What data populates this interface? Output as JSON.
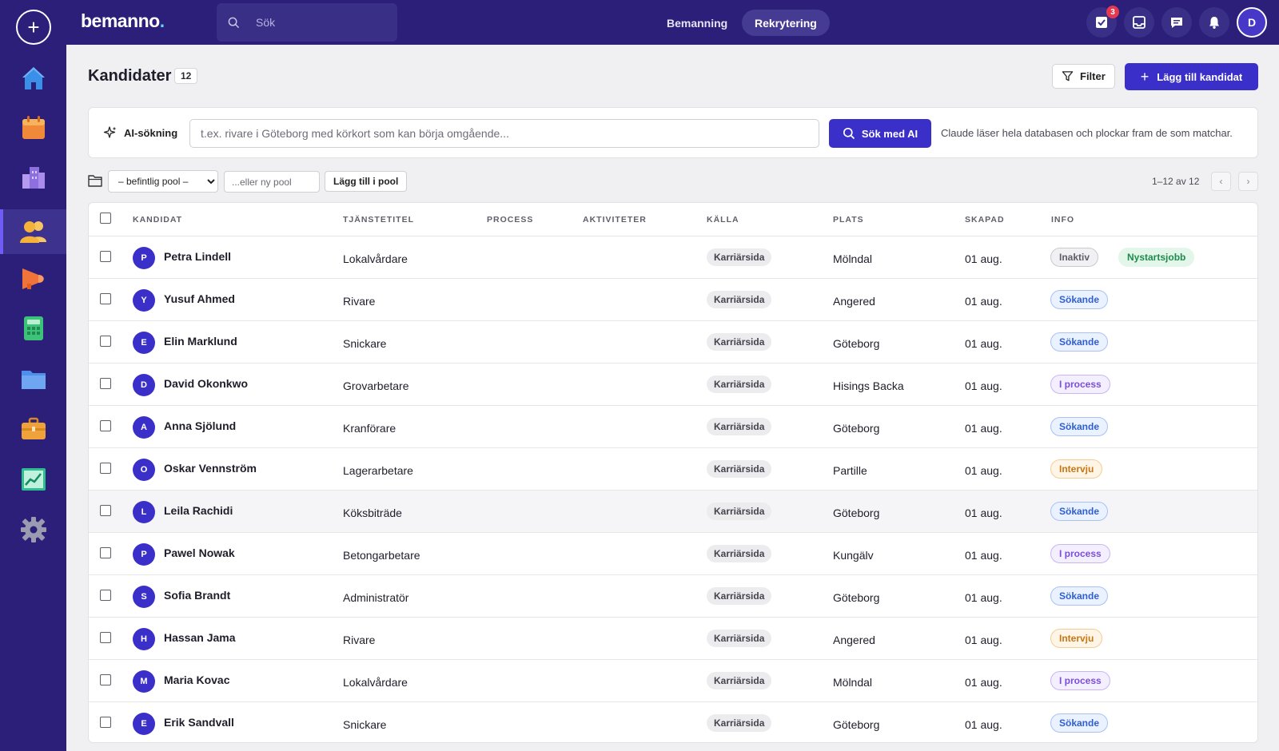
{
  "app": {
    "logo": "bemanno",
    "logo_dot": "."
  },
  "search": {
    "placeholder": "Sök"
  },
  "nav": {
    "tabs": [
      {
        "label": "Bemanning"
      },
      {
        "label": "Rekrytering"
      }
    ]
  },
  "top_actions": {
    "tasks_badge": "3",
    "user_initial": "D"
  },
  "sidebar": {
    "items": [
      {
        "icon": "home-icon",
        "color": "#3a8fe8"
      },
      {
        "icon": "calendar-icon",
        "color": "#f08a3a"
      },
      {
        "icon": "building-icon",
        "color": "#8e6fe0"
      },
      {
        "icon": "users-icon",
        "color": "#f4b23a"
      },
      {
        "icon": "megaphone-icon",
        "color": "#f0733a"
      },
      {
        "icon": "calculator-icon",
        "color": "#3dc27a"
      },
      {
        "icon": "folder-icon",
        "color": "#4d8fea"
      },
      {
        "icon": "briefcase-icon",
        "color": "#f0a23a"
      },
      {
        "icon": "chart-icon",
        "color": "#2fbf8f"
      },
      {
        "icon": "settings-icon",
        "color": "#9a9ab0"
      }
    ]
  },
  "header": {
    "title": "Kandidater",
    "count": "12",
    "filter_label": "Filter",
    "add_label": "Lägg till kandidat"
  },
  "ai_search": {
    "label": "AI-sökning",
    "placeholder": "t.ex. rivare i Göteborg med körkort som kan börja omgående...",
    "button": "Sök med AI",
    "hint": "Claude läser hela databasen och plockar fram de som matchar."
  },
  "pool": {
    "select_value": "– befintlig pool –",
    "new_placeholder": "...eller ny pool",
    "add_button": "Lägg till i pool",
    "pager_text": "1–12 av 12",
    "prev": "‹",
    "next": "›"
  },
  "table": {
    "columns": [
      "KANDIDAT",
      "TJÄNSTETITEL",
      "PROCESS",
      "AKTIVITETER",
      "KÄLLA",
      "PLATS",
      "SKAPAD",
      "INFO"
    ],
    "rows": [
      {
        "initial": "P",
        "name": "Petra Lindell",
        "title": "Lokalvårdare",
        "source": "Karriärsida",
        "place": "Mölndal",
        "created": "01 aug.",
        "tags": [
          {
            "label": "Inaktiv",
            "kind": "gray"
          },
          {
            "label": "Nystartsjobb",
            "kind": "green"
          }
        ]
      },
      {
        "initial": "Y",
        "name": "Yusuf Ahmed",
        "title": "Rivare",
        "source": "Karriärsida",
        "place": "Angered",
        "created": "01 aug.",
        "tags": [
          {
            "label": "Sökande",
            "kind": "blue"
          }
        ]
      },
      {
        "initial": "E",
        "name": "Elin Marklund",
        "title": "Snickare",
        "source": "Karriärsida",
        "place": "Göteborg",
        "created": "01 aug.",
        "tags": [
          {
            "label": "Sökande",
            "kind": "blue"
          }
        ]
      },
      {
        "initial": "D",
        "name": "David Okonkwo",
        "title": "Grovarbetare",
        "source": "Karriärsida",
        "place": "Hisings Backa",
        "created": "01 aug.",
        "tags": [
          {
            "label": "I process",
            "kind": "purple"
          }
        ]
      },
      {
        "initial": "A",
        "name": "Anna Sjölund",
        "title": "Kranförare",
        "source": "Karriärsida",
        "place": "Göteborg",
        "created": "01 aug.",
        "tags": [
          {
            "label": "Sökande",
            "kind": "blue"
          }
        ]
      },
      {
        "initial": "O",
        "name": "Oskar Vennström",
        "title": "Lagerarbetare",
        "source": "Karriärsida",
        "place": "Partille",
        "created": "01 aug.",
        "tags": [
          {
            "label": "Intervju",
            "kind": "orange"
          }
        ]
      },
      {
        "initial": "L",
        "name": "Leila Rachidi",
        "title": "Köksbiträde",
        "source": "Karriärsida",
        "place": "Göteborg",
        "created": "01 aug.",
        "tags": [
          {
            "label": "Sökande",
            "kind": "blue"
          }
        ],
        "highlight": true
      },
      {
        "initial": "P",
        "name": "Pawel Nowak",
        "title": "Betongarbetare",
        "source": "Karriärsida",
        "place": "Kungälv",
        "created": "01 aug.",
        "tags": [
          {
            "label": "I process",
            "kind": "purple"
          }
        ]
      },
      {
        "initial": "S",
        "name": "Sofia Brandt",
        "title": "Administratör",
        "source": "Karriärsida",
        "place": "Göteborg",
        "created": "01 aug.",
        "tags": [
          {
            "label": "Sökande",
            "kind": "blue"
          }
        ]
      },
      {
        "initial": "H",
        "name": "Hassan Jama",
        "title": "Rivare",
        "source": "Karriärsida",
        "place": "Angered",
        "created": "01 aug.",
        "tags": [
          {
            "label": "Intervju",
            "kind": "orange"
          }
        ]
      },
      {
        "initial": "M",
        "name": "Maria Kovac",
        "title": "Lokalvårdare",
        "source": "Karriärsida",
        "place": "Mölndal",
        "created": "01 aug.",
        "tags": [
          {
            "label": "I process",
            "kind": "purple"
          }
        ]
      },
      {
        "initial": "E",
        "name": "Erik Sandvall",
        "title": "Snickare",
        "source": "Karriärsida",
        "place": "Göteborg",
        "created": "01 aug.",
        "tags": [
          {
            "label": "Sökande",
            "kind": "blue"
          }
        ]
      }
    ]
  },
  "tag_colors": {
    "gray": {
      "bg": "#f1f1f4",
      "border": "#c9c9d2",
      "text": "#5d5d68"
    },
    "green": {
      "bg": "#e3f6ea",
      "border": "#e3f6ea",
      "text": "#1f8a4c"
    },
    "blue": {
      "bg": "#eaf1ff",
      "border": "#a9c2f2",
      "text": "#2f5fd0"
    },
    "purple": {
      "bg": "#f4efff",
      "border": "#c9b5f2",
      "text": "#7a4fd8"
    },
    "orange": {
      "bg": "#fff5e6",
      "border": "#f3cd96",
      "text": "#c57713"
    }
  }
}
